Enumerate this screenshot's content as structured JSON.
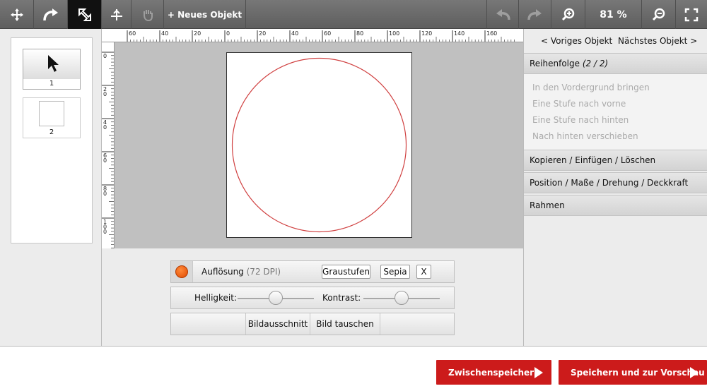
{
  "toolbar": {
    "new_object_label": "+ Neues Objekt",
    "zoom_level": "81 %"
  },
  "layers": [
    {
      "label": "1"
    },
    {
      "label": "2"
    }
  ],
  "rulers": {
    "top_numbers": [
      "60",
      "40",
      "20",
      "0",
      "20",
      "40",
      "60",
      "80",
      "100",
      "120",
      "140",
      "160"
    ],
    "left_numbers": [
      "0",
      "20",
      "40",
      "60",
      "80",
      "100"
    ]
  },
  "image_controls": {
    "resolution_label": "Auflösung",
    "resolution_value": "(72 DPI)",
    "grayscale_button": "Graustufen",
    "sepia_button": "Sepia",
    "reset_button": "X",
    "brightness_label": "Helligkeit:",
    "contrast_label": "Kontrast:",
    "brightness_level": 0.5,
    "contrast_level": 0.5,
    "crop_button": "Bildausschnitt",
    "swap_image_button": "Bild tauschen"
  },
  "right_panel": {
    "prev_object": "< Voriges Objekt",
    "next_object": "Nächstes Objekt >",
    "order_title": "Reihenfolge",
    "order_count": "(2 / 2)",
    "order_items": [
      "In den Vordergrund bringen",
      "Eine Stufe nach vorne",
      "Eine Stufe nach hinten",
      "Nach hinten verschieben"
    ],
    "copy_section": "Kopieren / Einfügen / Löschen",
    "position_section": "Position / Maße / Drehung / Deckkraft",
    "frame_section": "Rahmen"
  },
  "footer": {
    "save_temp": "Zwischenspeichern",
    "save_preview": "Speichern und zur Vorschau"
  },
  "colors": {
    "accent_red": "#cc1b1b",
    "circle_stroke": "#d04040",
    "toolbar_bg": "#666666",
    "status_dot": "#ff6a10"
  }
}
